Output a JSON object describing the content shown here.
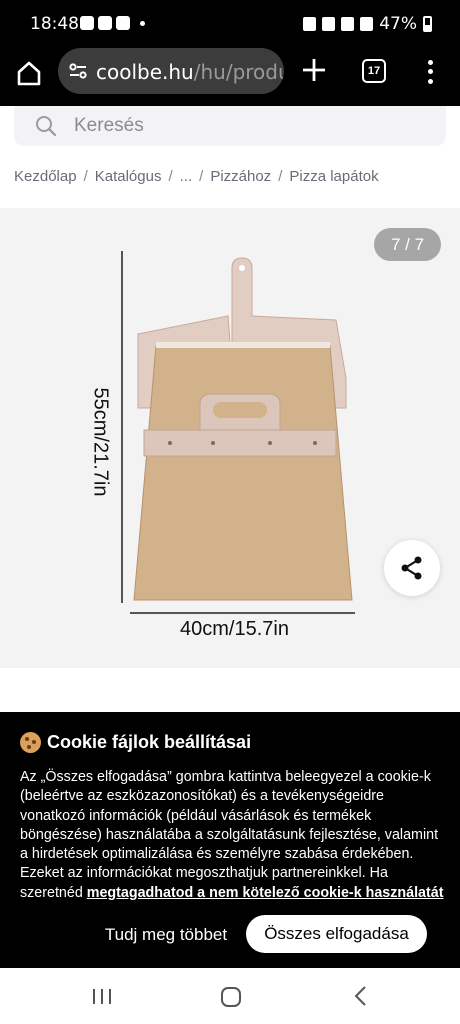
{
  "status_bar": {
    "time": "18:48",
    "battery": "47%"
  },
  "browser": {
    "url_host": "coolbe.hu",
    "url_path": "/hu/produ",
    "tab_count": "17"
  },
  "search": {
    "placeholder": "Keresés"
  },
  "breadcrumb": [
    "Kezdőlap",
    "Katalógus",
    "...",
    "Pizzához",
    "Pizza lapátok"
  ],
  "breadcrumb_separator": "/",
  "gallery": {
    "counter": "7 / 7",
    "height_label": "55cm/21.7in",
    "width_label": "40cm/15.7in"
  },
  "cookie": {
    "title": "Cookie fájlok beállításai",
    "body": "Az „Összes elfogadása” gombra kattintva beleegyezel a cookie-k (beleértve az eszközazonosítókat) és a tevékenységeidre vonatkozó információk (például vásárlások és termékek böngészése) használatába a szolgáltatásunk fejlesztése, valamint a hirdetések optimalizálása és személyre szabása érdekében. Ezeket az információkat megoszthatjuk partnereinkkel. Ha szeretnéd ",
    "link": "megtagadhatod a nem kötelező cookie-k használatát",
    "more_button": "Tudj meg többet",
    "accept_button": "Összes elfogadása"
  },
  "colors": {
    "banner_bg": "#000000",
    "board": "#d2b28a",
    "handle_wood": "#d8c2b6"
  }
}
